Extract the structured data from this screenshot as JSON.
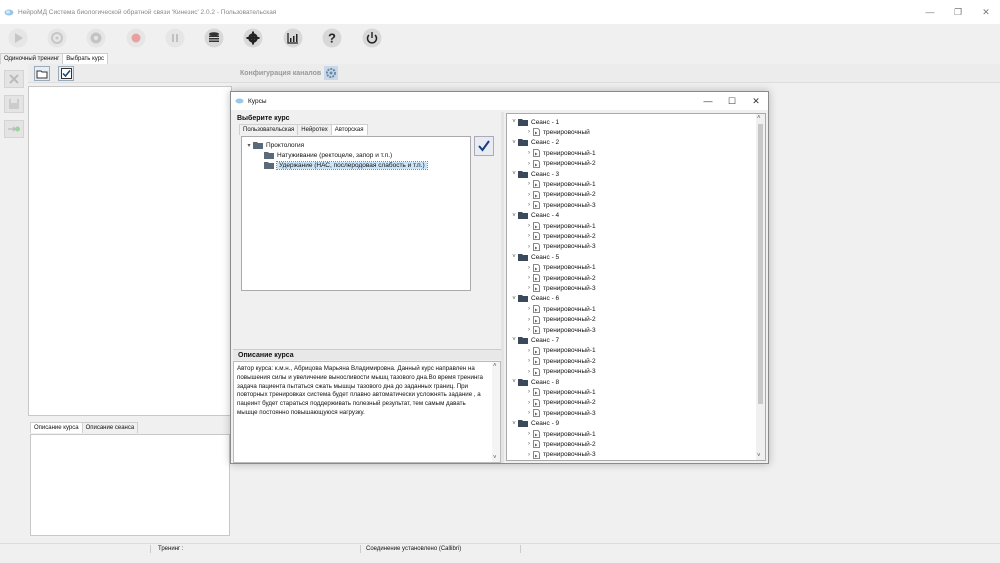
{
  "window": {
    "title": "НейроМД Система биологической обратной связи 'Кинезис' 2.0.2 - Пользовательская",
    "controls": [
      "—",
      "❐",
      "✕"
    ]
  },
  "toolbar": {
    "buttons": [
      "play",
      "record-target",
      "gear-grey",
      "record",
      "pause",
      "database",
      "settings",
      "chart",
      "help",
      "power"
    ]
  },
  "main_tabs": [
    {
      "label": "Одиночный тренинг",
      "active": false
    },
    {
      "label": "Выбрать курс",
      "active": true
    }
  ],
  "subbar": {
    "config_label": "Конфигурация каналов"
  },
  "left_desc_tabs": [
    {
      "label": "Описание курса",
      "active": true
    },
    {
      "label": "Описание сеанса",
      "active": false
    }
  ],
  "statusbar": {
    "training": "Тренинг :",
    "connection": "Соединение установлено (Callibri)"
  },
  "dialog": {
    "title": "Курсы",
    "choose_label": "Выберите курс",
    "tabs": [
      {
        "label": "Пользовательская",
        "active": false
      },
      {
        "label": "Нейротех",
        "active": false
      },
      {
        "label": "Авторская",
        "active": true
      }
    ],
    "tree": {
      "root": "Проктология",
      "children": [
        {
          "label": "Натуживание (ректоцеле, запор и т.п.)",
          "selected": false
        },
        {
          "label": "Удержание (НАС, послеродовая слабость и т.п.)",
          "selected": true
        }
      ]
    },
    "description_header": "Описание курса",
    "description_text": "Автор курса: к.м.н., Абрицова Марьяна Владимировна. Данный курс направлен на повышения силы и увеличение выносливости мышц тазового дна.Во время тренинга задача пациента пытаться сжать мышцы тазового дна до заданных границ. При повторных тренировках система будет плавно автоматически усложнять задание , а пацеинт будет стараться поддерживать полезный результат, тем самым давать мышце постоянно повышающуюся нагрузку.",
    "sessions": [
      {
        "name": "Сеанс - 1",
        "items": [
          "тренировочный"
        ]
      },
      {
        "name": "Сеанс - 2",
        "items": [
          "тренировочный-1",
          "тренировочный-2"
        ]
      },
      {
        "name": "Сеанс - 3",
        "items": [
          "тренировочный-1",
          "тренировочный-2",
          "тренировочный-3"
        ]
      },
      {
        "name": "Сеанс - 4",
        "items": [
          "тренировочный-1",
          "тренировочный-2",
          "тренировочный-3"
        ]
      },
      {
        "name": "Сеанс - 5",
        "items": [
          "тренировочный-1",
          "тренировочный-2",
          "тренировочный-3"
        ]
      },
      {
        "name": "Сеанс - 6",
        "items": [
          "тренировочный-1",
          "тренировочный-2",
          "тренировочный-3"
        ]
      },
      {
        "name": "Сеанс - 7",
        "items": [
          "тренировочный-1",
          "тренировочный-2",
          "тренировочный-3"
        ]
      },
      {
        "name": "Сеанс - 8",
        "items": [
          "тренировочный-1",
          "тренировочный-2",
          "тренировочный-3"
        ]
      },
      {
        "name": "Сеанс - 9",
        "items": [
          "тренировочный-1",
          "тренировочный-2",
          "тренировочный-3"
        ]
      }
    ]
  }
}
